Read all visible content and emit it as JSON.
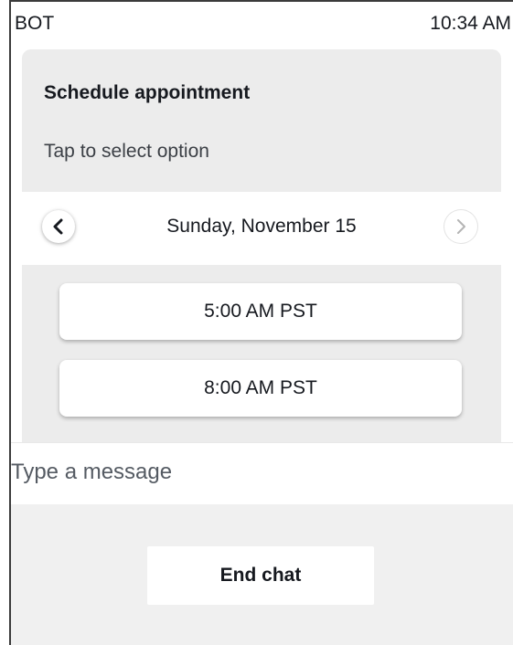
{
  "status_bar": {
    "sender": "BOT",
    "time": "10:34 AM"
  },
  "card": {
    "title": "Schedule appointment",
    "subtitle": "Tap to select option",
    "date": "Sunday, November 15",
    "prev_icon": "chevron-left-icon",
    "next_icon": "chevron-right-icon",
    "slots": [
      {
        "label": "5:00 AM PST"
      },
      {
        "label": "8:00 AM PST"
      }
    ]
  },
  "composer": {
    "placeholder": "Type a message",
    "value": ""
  },
  "footer": {
    "end_chat_label": "End chat"
  },
  "colors": {
    "card_background": "#ececec",
    "footer_background": "#f0f0f0",
    "text": "#16191f"
  }
}
